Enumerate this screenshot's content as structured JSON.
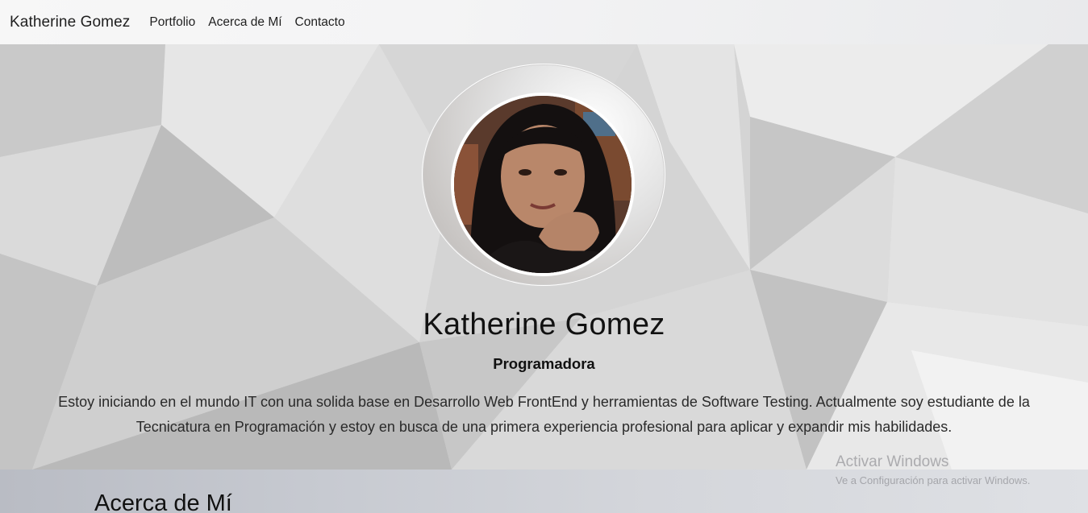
{
  "navbar": {
    "brand": "Katherine Gomez",
    "links": [
      "Portfolio",
      "Acerca de Mí",
      "Contacto"
    ]
  },
  "hero": {
    "name": "Katherine Gomez",
    "role": "Programadora",
    "bio": "Estoy iniciando en el mundo IT con una solida base en Desarrollo Web FrontEnd y herramientas de Software Testing. Actualmente soy estudiante de la Tecnicatura en Programación y estoy en busca de una primera experiencia profesional para aplicar y expandir mis habilidades."
  },
  "about": {
    "title": "Acerca de Mí"
  },
  "watermark": {
    "title": "Activar Windows",
    "subtitle": "Ve a Configuración para activar Windows."
  },
  "colors": {
    "text": "#111111",
    "navbar_bg": "#f4f4f5",
    "hero_bg": "#d3d3d3"
  }
}
